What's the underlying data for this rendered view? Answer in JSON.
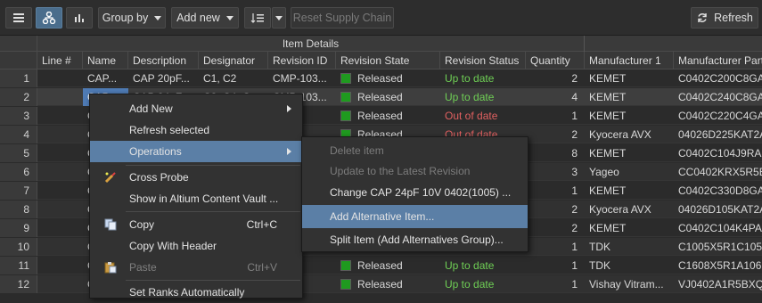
{
  "toolbar": {
    "group_by": "Group by",
    "add_new": "Add new",
    "reset": "Reset Supply Chain",
    "refresh": "Refresh"
  },
  "grid": {
    "group_title": "Item Details",
    "columns": [
      "Line #",
      "Name",
      "Description",
      "Designator",
      "Revision ID",
      "Revision State",
      "Revision Status",
      "Quantity",
      "Manufacturer 1",
      "Manufacturer Part"
    ],
    "rows": [
      {
        "num": "1",
        "name": "CAP...",
        "desc": "CAP 20pF...",
        "des": "C1, C2",
        "rev": "CMP-103...",
        "state": "Released",
        "status": "Up to date",
        "qty": "2",
        "mfr": "KEMET",
        "part": "C0402C200C8GAC"
      },
      {
        "num": "2",
        "name": "CAP",
        "desc": "CAP 24pF",
        "des": "C3, C4, C",
        "rev": "CMP-103...",
        "state": "Released",
        "status": "Up to date",
        "qty": "4",
        "mfr": "KEMET",
        "part": "C0402C240C8GAC"
      },
      {
        "num": "3",
        "name": "C",
        "desc": "",
        "des": "",
        "rev": "103...",
        "state": "Released",
        "status": "Out of date",
        "qty": "1",
        "mfr": "KEMET",
        "part": "C0402C220C4GAC"
      },
      {
        "num": "4",
        "name": "C",
        "desc": "",
        "des": "",
        "rev": "103...",
        "state": "Released",
        "status": "Out of date",
        "qty": "2",
        "mfr": "Kyocera AVX",
        "part": "04026D225KAT2A"
      },
      {
        "num": "5",
        "name": "C",
        "desc": "",
        "des": "",
        "rev": "",
        "state": "",
        "status": "",
        "qty": "8",
        "mfr": "KEMET",
        "part": "C0402C104J9RAC"
      },
      {
        "num": "6",
        "name": "C",
        "desc": "",
        "des": "",
        "rev": "",
        "state": "",
        "status": "",
        "qty": "3",
        "mfr": "Yageo",
        "part": "CC0402KRX5R5BB"
      },
      {
        "num": "7",
        "name": "C",
        "desc": "",
        "des": "",
        "rev": "",
        "state": "",
        "status": "",
        "qty": "1",
        "mfr": "KEMET",
        "part": "C0402C330D8GAC"
      },
      {
        "num": "8",
        "name": "C",
        "desc": "",
        "des": "",
        "rev": "",
        "state": "",
        "status": "",
        "qty": "2",
        "mfr": "Kyocera AVX",
        "part": "04026D105KAT2A"
      },
      {
        "num": "9",
        "name": "C",
        "desc": "",
        "des": "",
        "rev": "",
        "state": "",
        "status": "",
        "qty": "2",
        "mfr": "KEMET",
        "part": "C0402C104K4PAC"
      },
      {
        "num": "10",
        "name": "C",
        "desc": "",
        "des": "",
        "rev": "",
        "state": "",
        "status": "",
        "qty": "1",
        "mfr": "TDK",
        "part": "C1005X5R1C105K"
      },
      {
        "num": "11",
        "name": "C",
        "desc": "",
        "des": "",
        "rev": "103...",
        "state": "Released",
        "status": "Up to date",
        "qty": "1",
        "mfr": "TDK",
        "part": "C1608X5R1A106N"
      },
      {
        "num": "12",
        "name": "C",
        "desc": "",
        "des": "",
        "rev": "103...",
        "state": "Released",
        "status": "Up to date",
        "qty": "1",
        "mfr": "Vishay Vitram...",
        "part": "VJ0402A1R5BXQP"
      }
    ]
  },
  "menu": {
    "items": [
      {
        "label": "Add New",
        "shortcut": "",
        "submenu": true,
        "disabled": false
      },
      {
        "label": "Refresh selected",
        "shortcut": "",
        "submenu": false,
        "disabled": false
      },
      {
        "label": "Operations",
        "shortcut": "",
        "submenu": true,
        "disabled": false
      },
      {
        "label": "Cross Probe",
        "shortcut": "",
        "submenu": false,
        "disabled": false
      },
      {
        "label": "Show in Altium Content Vault ...",
        "shortcut": "",
        "submenu": false,
        "disabled": false
      },
      {
        "label": "Copy",
        "shortcut": "Ctrl+C",
        "submenu": false,
        "disabled": false
      },
      {
        "label": "Copy With Header",
        "shortcut": "",
        "submenu": false,
        "disabled": false
      },
      {
        "label": "Paste",
        "shortcut": "Ctrl+V",
        "submenu": false,
        "disabled": true
      },
      {
        "label": "Set Ranks Automatically",
        "shortcut": "",
        "submenu": false,
        "disabled": false
      }
    ]
  },
  "submenu": {
    "items": [
      {
        "label": "Delete item",
        "disabled": true
      },
      {
        "label": "Update to the Latest Revision",
        "disabled": true
      },
      {
        "label": "Change CAP 24pF 10V 0402(1005) ...",
        "disabled": false
      },
      {
        "label": "Add Alternative Item...",
        "disabled": false
      },
      {
        "label": "Split Item (Add Alternatives Group)...",
        "disabled": false
      }
    ]
  },
  "colors": {
    "accent": "#5b7fa6",
    "released": "#1f9a1f",
    "up_to_date": "#6fcf55",
    "out_of_date": "#e06060"
  }
}
